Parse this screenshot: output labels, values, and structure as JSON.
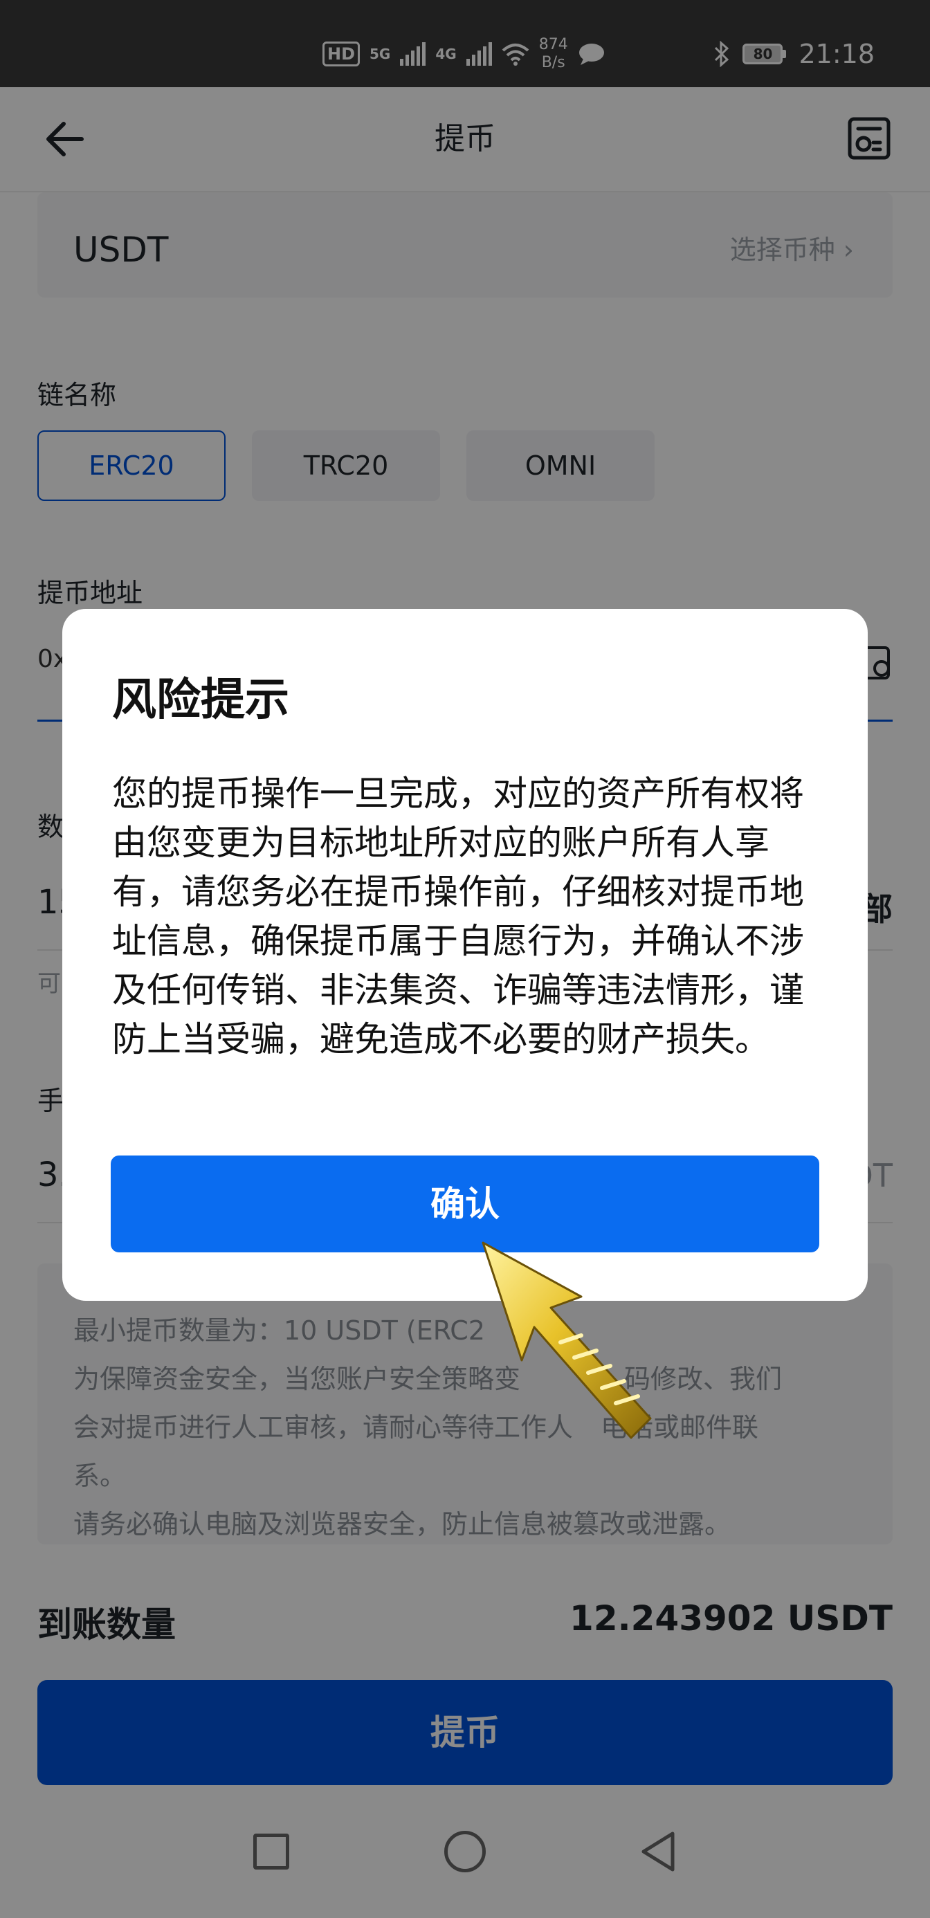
{
  "status_bar": {
    "hd": "HD",
    "net1": "5G",
    "net2": "4G",
    "speed_value": "874",
    "speed_unit": "B/s",
    "battery": "80",
    "time": "21:18"
  },
  "header": {
    "title": "提币"
  },
  "coin": {
    "name": "USDT",
    "select_label": "选择币种"
  },
  "chain": {
    "label": "链名称",
    "options": [
      "ERC20",
      "TRC20",
      "OMNI"
    ],
    "selected": "ERC20"
  },
  "address": {
    "label": "提币地址",
    "value_visible": "0x"
  },
  "amount": {
    "label_visible": "数",
    "value_visible": "15",
    "all_visible": "部",
    "available_visible": "可"
  },
  "fee": {
    "label_visible": "手",
    "value_visible": "3.",
    "unit_visible": "DT"
  },
  "notes": {
    "lines": [
      "最小提币数量为：10 USDT (ERC2",
      "为保障资金安全，当您账户安全策略变",
      "会对提币进行人工审核，请耐心等待工作人",
      "系。",
      "请务必确认电脑及浏览器安全，防止信息被篡改或泄露。"
    ],
    "tails": [
      "",
      "码修改、我们",
      "电话或邮件联",
      "",
      ""
    ]
  },
  "receive": {
    "label": "到账数量",
    "value": "12.243902 USDT"
  },
  "submit_label": "提币",
  "dialog": {
    "title": "风险提示",
    "body": "您的提币操作一旦完成，对应的资产所有权将由您变更为目标地址所对应的账户所有人享有，请您务必在提币操作前，仔细核对提币地址信息，确保提币属于自愿行为，并确认不涉及任何传销、非法集资、诈骗等违法情形，谨防上当受骗，避免造成不必要的财产损失。",
    "confirm_label": "确认"
  },
  "colors": {
    "primary": "#0052d9",
    "confirm": "#0a6cf0",
    "cursor": "#e8c22a"
  }
}
